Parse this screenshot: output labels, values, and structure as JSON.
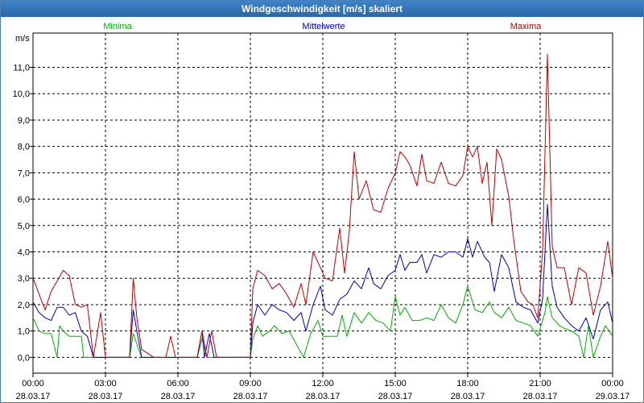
{
  "window": {
    "title": "Windgeschwindigkeit [m/s] skaliert"
  },
  "chart_data": {
    "type": "line",
    "ylabel": "m/s",
    "ylim": [
      -0.6,
      12.3
    ],
    "yticks": [
      0,
      1,
      2,
      3,
      4,
      5,
      6,
      7,
      8,
      9,
      10,
      11
    ],
    "ytick_labels": [
      "0,0",
      "1,0",
      "2,0",
      "3,0",
      "4,0",
      "5,0",
      "6,0",
      "7,0",
      "8,0",
      "9,0",
      "10,0",
      "11,0"
    ],
    "xlim": [
      0,
      24
    ],
    "xticks": [
      0,
      3,
      6,
      9,
      12,
      15,
      18,
      21,
      24
    ],
    "xtick_labels": [
      {
        "time": "00:00",
        "date": "28.03.17"
      },
      {
        "time": "03:00",
        "date": "28.03.17"
      },
      {
        "time": "06:00",
        "date": "28.03.17"
      },
      {
        "time": "09:00",
        "date": "28.03.17"
      },
      {
        "time": "12:00",
        "date": "28.03.17"
      },
      {
        "time": "15:00",
        "date": "28.03.17"
      },
      {
        "time": "18:00",
        "date": "28.03.17"
      },
      {
        "time": "21:00",
        "date": "28.03.17"
      },
      {
        "time": "00:00",
        "date": "29.03.17"
      }
    ],
    "grid": true,
    "legend_position": "top",
    "series": [
      {
        "name": "Minima",
        "color": "#00b000",
        "points": [
          [
            0,
            1.5
          ],
          [
            0.25,
            1.0
          ],
          [
            0.5,
            0.9
          ],
          [
            0.75,
            0.9
          ],
          [
            1,
            0.0
          ],
          [
            1.1,
            1.2
          ],
          [
            1.25,
            1.0
          ],
          [
            1.5,
            0.8
          ],
          [
            1.75,
            0.8
          ],
          [
            2,
            0.8
          ],
          [
            2.1,
            0.0
          ],
          [
            2.5,
            0.0
          ],
          [
            3,
            0.0
          ],
          [
            4,
            0.0
          ],
          [
            4.15,
            0.9
          ],
          [
            4.3,
            0.5
          ],
          [
            4.5,
            0.0
          ],
          [
            5,
            0.0
          ],
          [
            6,
            0.0
          ],
          [
            6.8,
            0.0
          ],
          [
            7,
            0.7
          ],
          [
            7.2,
            0.0
          ],
          [
            8,
            0.0
          ],
          [
            9,
            0.0
          ],
          [
            9.1,
            0.7
          ],
          [
            9.3,
            1.2
          ],
          [
            9.5,
            0.8
          ],
          [
            9.8,
            1.0
          ],
          [
            10,
            1.2
          ],
          [
            10.3,
            0.9
          ],
          [
            10.6,
            1.0
          ],
          [
            10.9,
            0.5
          ],
          [
            11.2,
            0.0
          ],
          [
            11.5,
            0.9
          ],
          [
            11.8,
            1.4
          ],
          [
            12,
            0.8
          ],
          [
            12.3,
            0.8
          ],
          [
            12.6,
            0.8
          ],
          [
            12.8,
            1.6
          ],
          [
            13,
            0.8
          ],
          [
            13.3,
            1.7
          ],
          [
            13.6,
            1.3
          ],
          [
            13.9,
            1.7
          ],
          [
            14.2,
            1.4
          ],
          [
            14.5,
            1.3
          ],
          [
            14.8,
            1.0
          ],
          [
            15,
            2.3
          ],
          [
            15.2,
            1.6
          ],
          [
            15.4,
            1.9
          ],
          [
            15.7,
            1.4
          ],
          [
            16,
            1.4
          ],
          [
            16.3,
            1.5
          ],
          [
            16.6,
            1.4
          ],
          [
            16.9,
            2.0
          ],
          [
            17.2,
            1.5
          ],
          [
            17.5,
            1.3
          ],
          [
            17.8,
            2.0
          ],
          [
            18,
            2.7
          ],
          [
            18.3,
            1.8
          ],
          [
            18.6,
            1.7
          ],
          [
            18.9,
            2.1
          ],
          [
            19.1,
            1.7
          ],
          [
            19.4,
            1.5
          ],
          [
            19.7,
            1.9
          ],
          [
            20,
            1.4
          ],
          [
            20.3,
            1.3
          ],
          [
            20.6,
            1.2
          ],
          [
            20.9,
            0.8
          ],
          [
            21.2,
            1.7
          ],
          [
            21.3,
            2.3
          ],
          [
            21.5,
            1.5
          ],
          [
            21.8,
            1.2
          ],
          [
            22,
            1.1
          ],
          [
            22.3,
            1.0
          ],
          [
            22.6,
            0.8
          ],
          [
            22.8,
            0.0
          ],
          [
            23,
            1.2
          ],
          [
            23.2,
            0.0
          ],
          [
            23.5,
            0.8
          ],
          [
            23.7,
            1.2
          ],
          [
            24,
            0.8
          ]
        ]
      },
      {
        "name": "Mittelwerte",
        "color": "#0000c0",
        "points": [
          [
            0,
            2.1
          ],
          [
            0.25,
            1.7
          ],
          [
            0.5,
            1.5
          ],
          [
            0.75,
            1.4
          ],
          [
            1,
            1.9
          ],
          [
            1.25,
            1.9
          ],
          [
            1.5,
            1.6
          ],
          [
            1.75,
            1.7
          ],
          [
            2,
            1.0
          ],
          [
            2.25,
            0.8
          ],
          [
            2.5,
            0.0
          ],
          [
            2.8,
            0.0
          ],
          [
            3,
            0.0
          ],
          [
            4,
            0.0
          ],
          [
            4.15,
            1.8
          ],
          [
            4.3,
            1.0
          ],
          [
            4.5,
            0.0
          ],
          [
            5,
            0.0
          ],
          [
            6,
            0.0
          ],
          [
            6.8,
            0.0
          ],
          [
            7,
            1.0
          ],
          [
            7.1,
            0.0
          ],
          [
            7.3,
            0.9
          ],
          [
            7.5,
            0.0
          ],
          [
            8,
            0.0
          ],
          [
            9,
            0.0
          ],
          [
            9.1,
            1.3
          ],
          [
            9.3,
            2.0
          ],
          [
            9.6,
            1.6
          ],
          [
            9.9,
            2.0
          ],
          [
            10.2,
            1.8
          ],
          [
            10.5,
            1.7
          ],
          [
            10.8,
            1.4
          ],
          [
            11.1,
            1.7
          ],
          [
            11.3,
            1.0
          ],
          [
            11.6,
            2.0
          ],
          [
            11.9,
            2.7
          ],
          [
            12.1,
            1.8
          ],
          [
            12.4,
            1.6
          ],
          [
            12.7,
            2.2
          ],
          [
            13,
            2.4
          ],
          [
            13.3,
            2.9
          ],
          [
            13.6,
            2.6
          ],
          [
            13.9,
            3.4
          ],
          [
            14.1,
            2.8
          ],
          [
            14.4,
            2.6
          ],
          [
            14.7,
            3.1
          ],
          [
            15,
            3.3
          ],
          [
            15.2,
            3.9
          ],
          [
            15.4,
            3.3
          ],
          [
            15.6,
            3.6
          ],
          [
            15.9,
            3.6
          ],
          [
            16.1,
            3.9
          ],
          [
            16.3,
            3.2
          ],
          [
            16.6,
            3.9
          ],
          [
            16.9,
            3.8
          ],
          [
            17.2,
            4.0
          ],
          [
            17.5,
            4.0
          ],
          [
            17.8,
            3.8
          ],
          [
            18,
            4.5
          ],
          [
            18.2,
            3.8
          ],
          [
            18.4,
            4.4
          ],
          [
            18.7,
            3.8
          ],
          [
            18.9,
            3.6
          ],
          [
            19.1,
            2.5
          ],
          [
            19.4,
            3.9
          ],
          [
            19.7,
            3.4
          ],
          [
            20,
            2.1
          ],
          [
            20.3,
            1.9
          ],
          [
            20.6,
            1.8
          ],
          [
            20.9,
            1.3
          ],
          [
            21.1,
            2.2
          ],
          [
            21.3,
            5.8
          ],
          [
            21.5,
            2.7
          ],
          [
            21.7,
            1.9
          ],
          [
            22,
            1.5
          ],
          [
            22.3,
            1.2
          ],
          [
            22.6,
            1.0
          ],
          [
            22.9,
            1.5
          ],
          [
            23.2,
            0.7
          ],
          [
            23.5,
            1.8
          ],
          [
            23.8,
            2.1
          ],
          [
            24,
            1.3
          ]
        ]
      },
      {
        "name": "Maxima",
        "color": "#c00000",
        "points": [
          [
            0,
            3.0
          ],
          [
            0.25,
            2.4
          ],
          [
            0.5,
            1.8
          ],
          [
            0.75,
            2.5
          ],
          [
            1,
            2.9
          ],
          [
            1.25,
            3.3
          ],
          [
            1.5,
            3.1
          ],
          [
            1.75,
            2.0
          ],
          [
            2,
            1.9
          ],
          [
            2.25,
            2.0
          ],
          [
            2.5,
            0.0
          ],
          [
            2.8,
            1.7
          ],
          [
            3,
            0.0
          ],
          [
            4,
            0.0
          ],
          [
            4.15,
            3.0
          ],
          [
            4.3,
            1.5
          ],
          [
            4.5,
            0.3
          ],
          [
            5,
            0.0
          ],
          [
            5.5,
            0.0
          ],
          [
            5.7,
            0.8
          ],
          [
            5.9,
            0.0
          ],
          [
            6.8,
            0.0
          ],
          [
            7,
            1.0
          ],
          [
            7.2,
            0.0
          ],
          [
            7.4,
            1.0
          ],
          [
            7.6,
            0.0
          ],
          [
            8,
            0.0
          ],
          [
            9,
            0.0
          ],
          [
            9.1,
            2.6
          ],
          [
            9.3,
            3.3
          ],
          [
            9.6,
            3.1
          ],
          [
            9.9,
            2.6
          ],
          [
            10.2,
            2.8
          ],
          [
            10.5,
            2.4
          ],
          [
            10.8,
            1.9
          ],
          [
            11.1,
            2.8
          ],
          [
            11.3,
            2.0
          ],
          [
            11.6,
            4.0
          ],
          [
            11.9,
            3.4
          ],
          [
            12.1,
            3.0
          ],
          [
            12.4,
            2.9
          ],
          [
            12.7,
            4.9
          ],
          [
            12.9,
            3.2
          ],
          [
            13.1,
            4.8
          ],
          [
            13.3,
            7.8
          ],
          [
            13.5,
            6.0
          ],
          [
            13.8,
            6.7
          ],
          [
            14.1,
            5.6
          ],
          [
            14.4,
            5.5
          ],
          [
            14.7,
            6.4
          ],
          [
            15,
            7.0
          ],
          [
            15.2,
            7.8
          ],
          [
            15.4,
            7.6
          ],
          [
            15.6,
            7.3
          ],
          [
            15.9,
            6.5
          ],
          [
            16.1,
            7.7
          ],
          [
            16.3,
            6.7
          ],
          [
            16.6,
            6.6
          ],
          [
            16.9,
            7.4
          ],
          [
            17.2,
            6.6
          ],
          [
            17.5,
            6.5
          ],
          [
            17.8,
            6.9
          ],
          [
            18,
            8.0
          ],
          [
            18.2,
            7.6
          ],
          [
            18.4,
            8.0
          ],
          [
            18.6,
            6.6
          ],
          [
            18.8,
            7.4
          ],
          [
            19,
            5.0
          ],
          [
            19.2,
            7.9
          ],
          [
            19.4,
            7.5
          ],
          [
            19.7,
            6.1
          ],
          [
            19.9,
            4.5
          ],
          [
            20.2,
            2.5
          ],
          [
            20.5,
            2.1
          ],
          [
            20.7,
            2.0
          ],
          [
            20.9,
            1.5
          ],
          [
            21.1,
            4.0
          ],
          [
            21.3,
            11.5
          ],
          [
            21.5,
            4.2
          ],
          [
            21.7,
            3.4
          ],
          [
            22,
            3.4
          ],
          [
            22.3,
            2.0
          ],
          [
            22.6,
            3.4
          ],
          [
            22.9,
            3.2
          ],
          [
            23.2,
            1.6
          ],
          [
            23.5,
            2.7
          ],
          [
            23.8,
            4.4
          ],
          [
            24,
            3.0
          ]
        ]
      }
    ]
  }
}
